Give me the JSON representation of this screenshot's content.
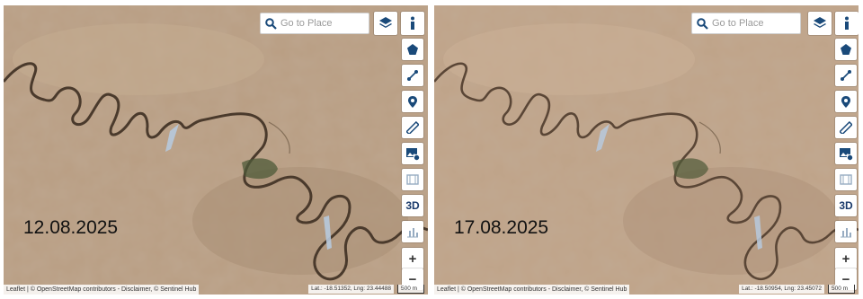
{
  "search": {
    "placeholder": "Go to Place"
  },
  "toolbar": {
    "info_icon": "info-icon",
    "layers_icon": "layers-icon",
    "tools": [
      "polygon-icon",
      "line-icon",
      "pin-icon",
      "ruler-icon",
      "image-download-icon",
      "film-icon",
      "3d-button",
      "chart-icon"
    ],
    "three_d_label": "3D",
    "zoom_in_label": "+",
    "zoom_out_label": "−"
  },
  "panels": [
    {
      "date": "12.08.2025",
      "attribution": "Leaflet | © OpenStreetMap contributors - Disclaimer, © Sentinel Hub",
      "coords": "Lat.: -18.51352, Lng: 23.44488",
      "scale": "500 m"
    },
    {
      "date": "17.08.2025",
      "attribution": "Leaflet | © OpenStreetMap contributors - Disclaimer, © Sentinel Hub",
      "coords": "Lat.: -18.50954, Lng: 23.45072",
      "scale": "500 m"
    }
  ],
  "colors": {
    "terrain": "#b99e83",
    "river": "#4a3a2c",
    "vegetation": "#4e5a38",
    "water": "#b7c9dd",
    "toolbar_icon": "#1a4a7a"
  }
}
